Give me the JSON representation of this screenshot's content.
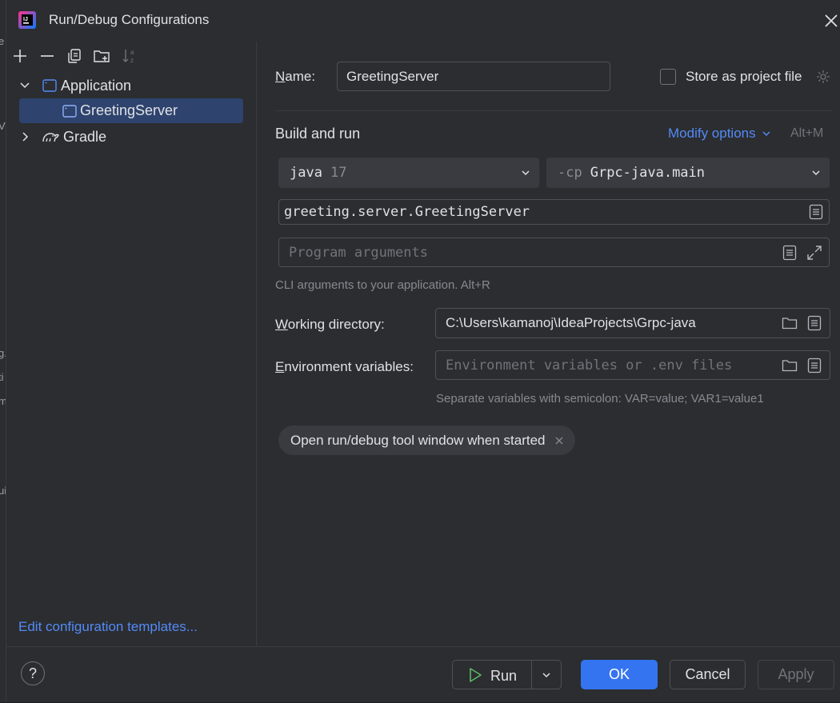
{
  "window": {
    "title": "Run/Debug Configurations"
  },
  "behind_fragments": [
    "e",
    "V",
    "g.",
    "ti",
    "m",
    "ui",
    "j"
  ],
  "toolbar": {
    "icons": [
      "add-icon",
      "remove-icon",
      "copy-icon",
      "new-folder-icon",
      "sort-icon"
    ]
  },
  "tree": {
    "application_label": "Application",
    "greeting_label": "GreetingServer",
    "gradle_label": "Gradle"
  },
  "left_footer": {
    "edit_templates": "Edit configuration templates..."
  },
  "name_row": {
    "label": "Name:",
    "value": "GreetingServer",
    "store_label": "Store as project file"
  },
  "build_run": {
    "heading": "Build and run",
    "modify_options": "Modify options",
    "shortcut": "Alt+M",
    "jdk_name": "java",
    "jdk_version": "17",
    "cp_prefix": "-cp",
    "cp_module": "Grpc-java.main",
    "main_class": "greeting.server.GreetingServer",
    "program_args_placeholder": "Program arguments",
    "cli_hint": "CLI arguments to your application. Alt+R"
  },
  "working_dir": {
    "label": "Working directory:",
    "value": "C:\\Users\\kamanoj\\IdeaProjects\\Grpc-java"
  },
  "env_vars": {
    "label": "Environment variables:",
    "placeholder": "Environment variables or .env files",
    "hint": "Separate variables with semicolon: VAR=value; VAR1=value1"
  },
  "chip": {
    "label": "Open run/debug tool window when started"
  },
  "buttons": {
    "help": "?",
    "run": "Run",
    "ok": "OK",
    "cancel": "Cancel",
    "apply": "Apply"
  },
  "colors": {
    "accent": "#3574f0",
    "link": "#548af7",
    "selection": "#2e436e",
    "run_icon": "#5fb865"
  }
}
